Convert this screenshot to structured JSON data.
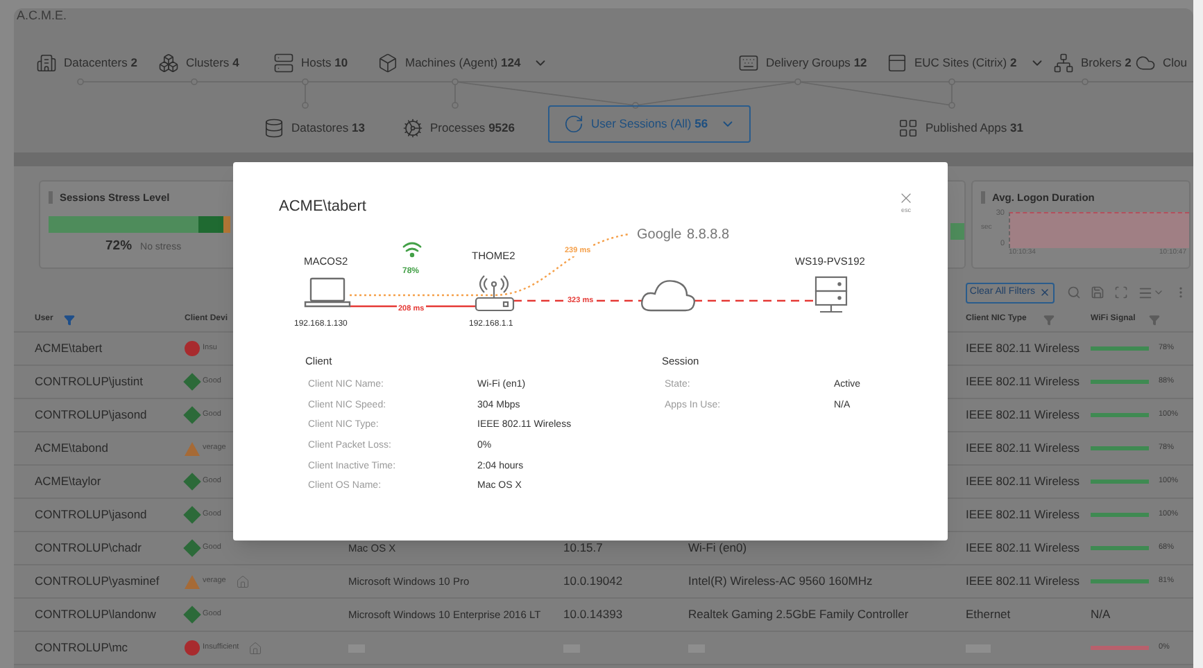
{
  "app_title": "A.C.M.E.",
  "nav": {
    "top": [
      {
        "label": "Datacenters",
        "count": "2",
        "selected": false,
        "dropdown": false
      },
      {
        "label": "Clusters",
        "count": "4",
        "selected": false,
        "dropdown": false
      },
      {
        "label": "Hosts",
        "count": "10",
        "selected": false,
        "dropdown": false
      },
      {
        "label": "Machines (Agent)",
        "count": "124",
        "selected": false,
        "dropdown": true
      },
      {
        "label": "Delivery Groups",
        "count": "12",
        "selected": false,
        "dropdown": false
      },
      {
        "label": "EUC Sites (Citrix)",
        "count": "2",
        "selected": false,
        "dropdown": true
      },
      {
        "label": "Brokers",
        "count": "2",
        "selected": false,
        "dropdown": false
      },
      {
        "label": "Clou",
        "selected": false,
        "dropdown": false
      }
    ],
    "second": [
      {
        "label": "Datastores",
        "count": "13",
        "selected": false,
        "dropdown": false
      },
      {
        "label": "Processes",
        "count": "9526",
        "selected": false,
        "dropdown": false
      },
      {
        "label": "User Sessions (All)",
        "count": "56",
        "selected": true,
        "dropdown": true
      },
      {
        "label": "Published Apps",
        "count": "31",
        "selected": false,
        "dropdown": false
      }
    ]
  },
  "cards": {
    "stress": {
      "title": "Sessions Stress Level",
      "reading": "72%",
      "caption": "No stress"
    },
    "logon": {
      "title": "Avg. Logon Duration",
      "y_max": "30",
      "y_min": "0",
      "unit": "sec",
      "times": [
        "10:10:34",
        "10:10:47"
      ]
    }
  },
  "toolbar": {
    "clear_filters": "Clear All Filters"
  },
  "table": {
    "columns": [
      {
        "label": "User",
        "filtered": true
      },
      {
        "label": "Client Devi"
      },
      {
        "label": "Client NIC Type",
        "filtered": false
      },
      {
        "label": "WiFi Signal",
        "filtered": false
      }
    ],
    "rows": [
      {
        "user": "ACME\\tabert",
        "device": {
          "kind": "insufficient",
          "label": "Insu"
        },
        "nic_type": "IEEE 802.11 Wireless",
        "wifi": {
          "color": "#3f8a52",
          "reading": "78%"
        }
      },
      {
        "user": "CONTROLUP\\justint",
        "device": {
          "kind": "good",
          "label": "Good"
        },
        "nic_type": "IEEE 802.11 Wireless",
        "wifi": {
          "color": "#3f8a52",
          "reading": "88%"
        }
      },
      {
        "user": "CONTROLUP\\jasond",
        "device": {
          "kind": "good",
          "label": "Good"
        },
        "nic_type": "IEEE 802.11 Wireless",
        "wifi": {
          "color": "#3f8a52",
          "reading": "100%"
        }
      },
      {
        "user": "ACME\\tabond",
        "device": {
          "kind": "average",
          "label": "verage"
        },
        "nic_type": "IEEE 802.11 Wireless",
        "wifi": {
          "color": "#3f8a52",
          "reading": "78%"
        }
      },
      {
        "user": "ACME\\taylor",
        "device": {
          "kind": "good",
          "label": "Good"
        },
        "nic_type": "IEEE 802.11 Wireless",
        "wifi": {
          "color": "#3f8a52",
          "reading": "100%"
        }
      },
      {
        "user": "CONTROLUP\\jasond",
        "device": {
          "kind": "good",
          "label": "Good"
        },
        "nic_type": "IEEE 802.11 Wireless",
        "wifi": {
          "color": "#3f8a52",
          "reading": "100%"
        }
      },
      {
        "user": "CONTROLUP\\chadr",
        "device": {
          "kind": "good",
          "label": "Good"
        },
        "home": false,
        "os": "Mac OS X",
        "os_version": "10.15.7",
        "nic_name": "Wi-Fi (en0)",
        "nic_type": "IEEE 802.11 Wireless",
        "wifi": {
          "color": "#3f8a52",
          "reading": "68%"
        }
      },
      {
        "user": "CONTROLUP\\yasminef",
        "device": {
          "kind": "average",
          "label": "verage"
        },
        "home": true,
        "os": "Microsoft Windows 10 Pro",
        "os_version": "10.0.19042",
        "nic_name": "Intel(R) Wireless-AC 9560 160MHz",
        "nic_type": "IEEE 802.11 Wireless",
        "wifi": {
          "color": "#3f8a52",
          "reading": "81%"
        }
      },
      {
        "user": "CONTROLUP\\landonw",
        "device": {
          "kind": "good",
          "label": "Good"
        },
        "home": false,
        "os": "Microsoft Windows 10 Enterprise 2016 LT",
        "os_version": "10.0.14393",
        "nic_name": "Realtek Gaming 2.5GbE Family Controller",
        "nic_type": "Ethernet",
        "wifi": {
          "reading": "N/A"
        }
      },
      {
        "user": "CONTROLUP\\mc",
        "device": {
          "kind": "insufficient",
          "label": "Insufficient"
        },
        "home": true,
        "loading": true,
        "wifi": {
          "color": "#b8606c",
          "reading": "0%"
        }
      }
    ]
  },
  "modal": {
    "title": "ACME\\tabert",
    "close_hint": "esc",
    "diagram": {
      "client": {
        "name": "MACOS2",
        "ip": "192.168.1.130"
      },
      "wifi_reading": "78%",
      "gateway": {
        "name": "THOME2",
        "ip": "192.168.1.1"
      },
      "probe": {
        "name": "Google",
        "ip": "8.8.8.8"
      },
      "server": {
        "name": "WS19-PVS192"
      },
      "client_gateway_latency": "208 ms",
      "probe_latency": "239 ms",
      "gateway_server_latency": "323 ms"
    },
    "sections": [
      {
        "title": "Client",
        "rows": [
          {
            "label": "Client NIC Name:",
            "value": "Wi-Fi (en1)"
          },
          {
            "label": "Client NIC Speed:",
            "value": "304 Mbps"
          },
          {
            "label": "Client NIC Type:",
            "value": "IEEE 802.11 Wireless"
          },
          {
            "label": "Client Packet Loss:",
            "value": "0%"
          },
          {
            "label": "Client Inactive Time:",
            "value": "2:04 hours"
          },
          {
            "label": "Client OS Name:",
            "value": "Mac OS X"
          }
        ]
      },
      {
        "title": "Session",
        "rows": [
          {
            "label": "State:",
            "value": "Active"
          },
          {
            "label": "Apps In Use:",
            "value": "N/A"
          }
        ]
      }
    ]
  }
}
